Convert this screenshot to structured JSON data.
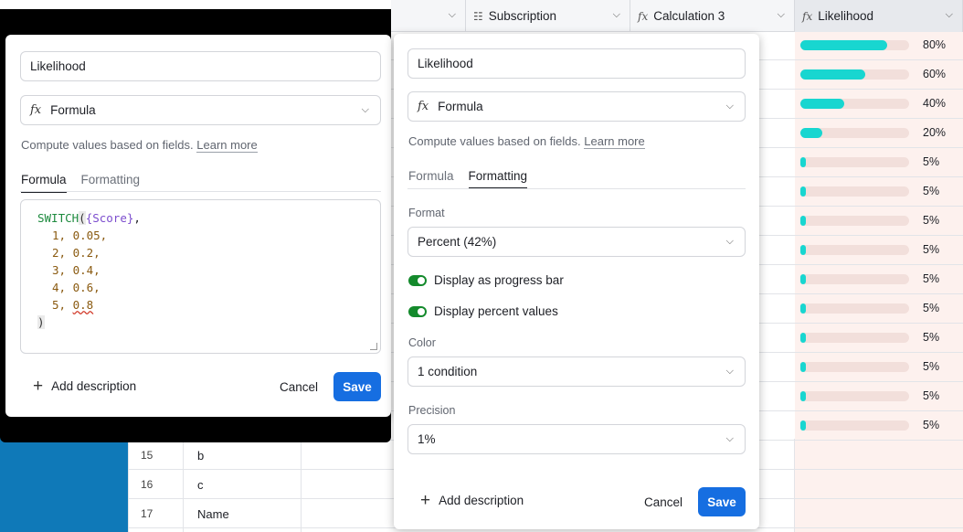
{
  "grid": {
    "columns": [
      {
        "label": "",
        "icon": ""
      },
      {
        "label": "Subscription",
        "icon": "list-icon"
      },
      {
        "label": "Calculation 3",
        "icon": "fx-icon"
      },
      {
        "label": "Likelihood",
        "icon": "fx-icon"
      }
    ],
    "progress_rows": [
      {
        "value": 0.8,
        "label": "80%"
      },
      {
        "value": 0.6,
        "label": "60%"
      },
      {
        "value": 0.4,
        "label": "40%"
      },
      {
        "value": 0.2,
        "label": "20%"
      },
      {
        "value": 0.05,
        "label": "5%"
      },
      {
        "value": 0.05,
        "label": "5%"
      },
      {
        "value": 0.05,
        "label": "5%"
      },
      {
        "value": 0.05,
        "label": "5%"
      },
      {
        "value": 0.05,
        "label": "5%"
      },
      {
        "value": 0.05,
        "label": "5%"
      },
      {
        "value": 0.05,
        "label": "5%"
      },
      {
        "value": 0.05,
        "label": "5%"
      },
      {
        "value": 0.05,
        "label": "5%"
      },
      {
        "value": 0.05,
        "label": "5%"
      }
    ],
    "rows": [
      {
        "num": "15",
        "text": "b"
      },
      {
        "num": "16",
        "text": "c"
      },
      {
        "num": "17",
        "text": "Name"
      }
    ],
    "accent_fill": "#18d6d0"
  },
  "left_dialog": {
    "name_value": "Likelihood",
    "type_value": "Formula",
    "helper_text": "Compute values based on fields.",
    "learn_more": "Learn more",
    "tab_formula": "Formula",
    "tab_formatting": "Formatting",
    "code": {
      "fn": "SWITCH",
      "open": "(",
      "ref": "{Score}",
      "after_ref": ",",
      "lines": [
        "1, 0.05,",
        "2, 0.2,",
        "3, 0.4,",
        "4, 0.6,"
      ],
      "last_key": "5, ",
      "last_val": "0.8",
      "close": ")"
    },
    "add_description": "Add description",
    "cancel": "Cancel",
    "save": "Save"
  },
  "right_dialog": {
    "name_value": "Likelihood",
    "type_value": "Formula",
    "helper_text": "Compute values based on fields.",
    "learn_more": "Learn more",
    "tab_formula": "Formula",
    "tab_formatting": "Formatting",
    "format_label": "Format",
    "format_value": "Percent (42%)",
    "toggle_progress": "Display as progress bar",
    "toggle_percent": "Display percent values",
    "color_label": "Color",
    "color_value": "1 condition",
    "precision_label": "Precision",
    "precision_value": "1%",
    "add_description": "Add description",
    "cancel": "Cancel",
    "save": "Save"
  }
}
